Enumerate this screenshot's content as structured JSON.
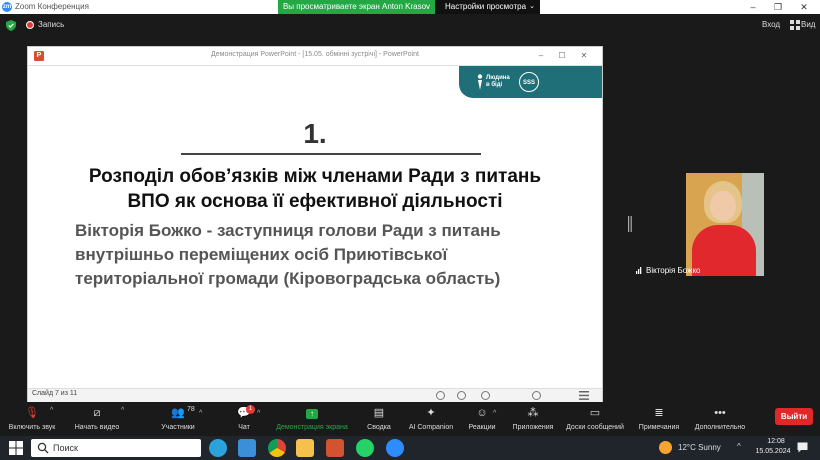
{
  "zoom": {
    "window_title": "Zoom Конференция",
    "share_banner": "Вы просматриваете экран Anton Krasov",
    "view_settings": "Настройки просмотра",
    "recording_label": "Запись",
    "exit_label": "Вход",
    "view_label": "Вид"
  },
  "powerpoint": {
    "window_title": "Демонстрация PowerPoint - [15.05. обмінні зустрічі] - PowerPoint",
    "slide_counter": "Слайд 7 из 11",
    "logo": {
      "text_line1": "Людина",
      "text_line2": "в біді",
      "badge": "SSS"
    },
    "slide": {
      "number": "1.",
      "title_line1": "Розподіл обов’язків між членами Ради з питань",
      "title_line2": "ВПО як основа її ефективної діяльності",
      "subtitle_line1": "Вікторія Божко - заступниця голови Ради з питань",
      "subtitle_line2": "внутрішньо переміщених осіб Приютівської",
      "subtitle_line3": "територіальної громади (Кіровоградська область)"
    }
  },
  "participant": {
    "name": "Вікторія Божко"
  },
  "toolbar": {
    "mute_label": "Включить звук",
    "video_label": "Начать видео",
    "participants_label": "Участники",
    "participants_count": "78",
    "chat_label": "Чат",
    "chat_badge": "1",
    "share_label": "Демонстрация экрана",
    "summary_label": "Сводка",
    "ai_label": "AI Companion",
    "reactions_label": "Реакции",
    "apps_label": "Приложения",
    "whiteboards_label": "Доски сообщений",
    "notes_label": "Примечания",
    "more_label": "Дополнительно",
    "leave_label": "Выйти"
  },
  "taskbar": {
    "search_placeholder": "Поиск",
    "weather": "12°C  Sunny",
    "time": "12:08",
    "date": "15.05.2024"
  },
  "colors": {
    "zoom_green": "#23a845",
    "leave_red": "#e02828",
    "logo_teal": "#1f6f78",
    "powerpoint_orange": "#d35230"
  }
}
